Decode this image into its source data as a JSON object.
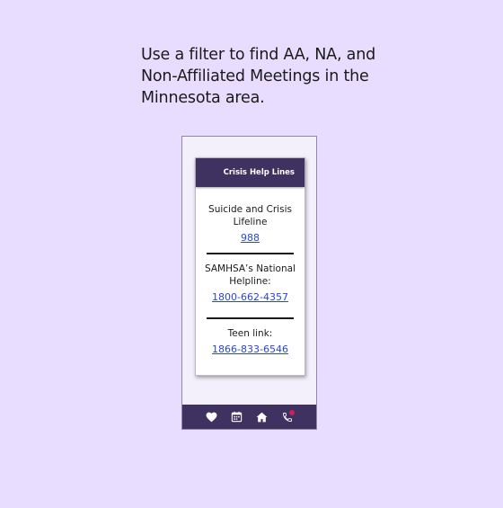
{
  "caption": {
    "text": "Use a filter to find AA, NA, and Non-Affiliated Meetings in the Minnesota area."
  },
  "card": {
    "title": "Crisis Help Lines",
    "entries": [
      {
        "label": "Suicide and Crisis Lifeline",
        "phone": "988"
      },
      {
        "label": "SAMHSA’s National Helpline:",
        "phone": "1800-662-4357"
      },
      {
        "label": "Teen link:",
        "phone": "1866-833-6546"
      }
    ]
  },
  "nav": {
    "items": [
      {
        "icon": "heart-icon",
        "active": false
      },
      {
        "icon": "calendar-icon",
        "active": false
      },
      {
        "icon": "home-icon",
        "active": false
      },
      {
        "icon": "phone-icon",
        "active": true
      }
    ]
  },
  "colors": {
    "background": "#e8ddff",
    "header": "#3f3160",
    "link": "#2b46d6",
    "active_dot": "#c2255c"
  }
}
